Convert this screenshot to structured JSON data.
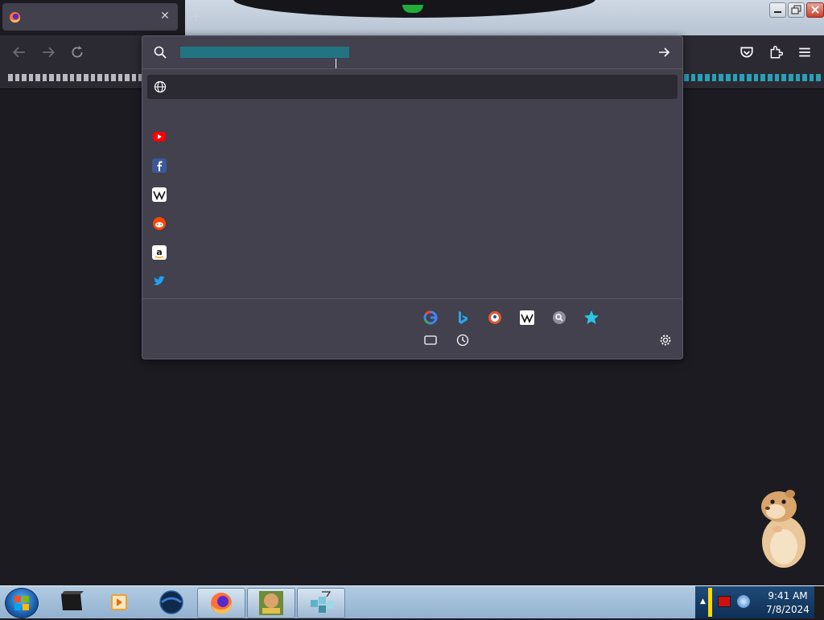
{
  "browser": {
    "tab": {
      "title": ""
    },
    "url_input": {
      "value": ""
    },
    "suggestion": {
      "label": ""
    },
    "shortcuts_heading": "",
    "shortcuts": [
      {
        "icon": "youtube-icon",
        "name": "",
        "domain": ""
      },
      {
        "icon": "facebook-icon",
        "name": "",
        "domain": ""
      },
      {
        "icon": "wikipedia-icon",
        "name": "",
        "domain": ""
      },
      {
        "icon": "reddit-icon",
        "name": "",
        "domain": ""
      },
      {
        "icon": "amazon-icon",
        "name": "",
        "domain": ""
      },
      {
        "icon": "twitter-icon",
        "name": "",
        "domain": ""
      }
    ],
    "oneoff_label": "",
    "engines": [
      "google-icon",
      "bing-icon",
      "duckduckgo-icon",
      "wikipedia-icon",
      "search-engine-icon",
      "bookmarks-star-icon"
    ],
    "colors": {
      "panel": "#42414d",
      "toolbar": "#2b2a33",
      "content": "#1c1b22",
      "accent": "#28c8e6"
    }
  },
  "taskbar": {
    "apps": [
      "terminal-icon",
      "media-player-icon",
      "web-browser-icon",
      "firefox-icon",
      "game-app-icon",
      "cubes-app-icon"
    ],
    "clock": {
      "time": "9:41 AM",
      "date": "7/8/2024"
    }
  }
}
